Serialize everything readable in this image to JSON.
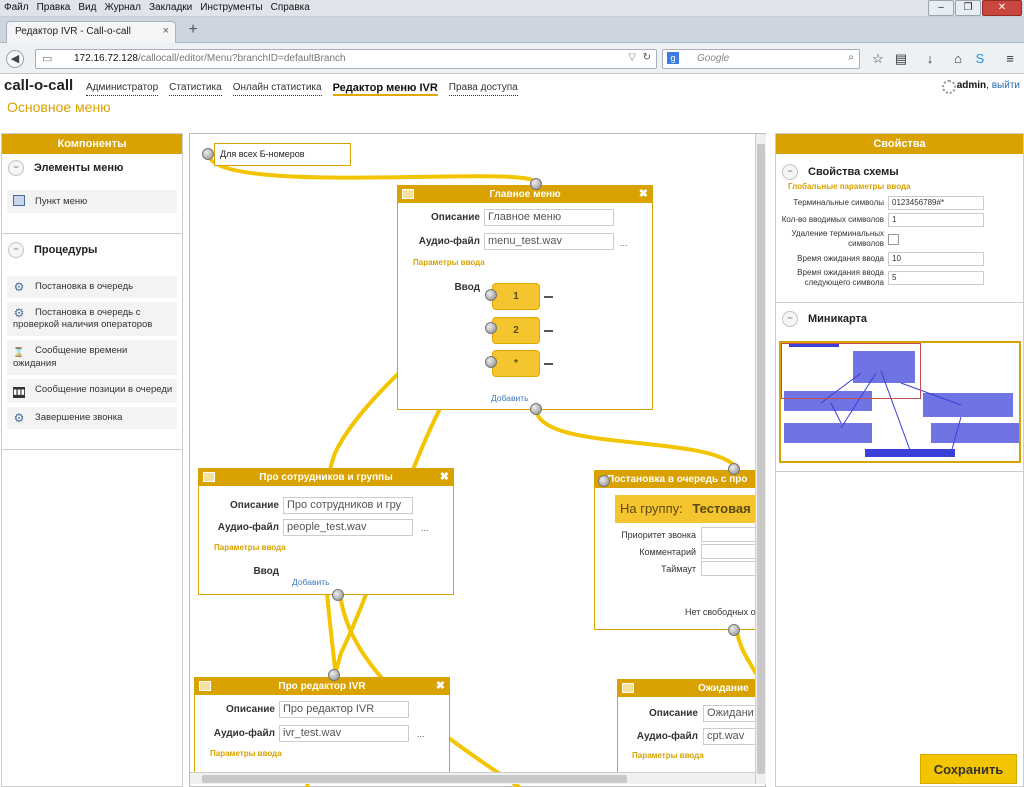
{
  "browser": {
    "menu": [
      "Файл",
      "Правка",
      "Вид",
      "Журнал",
      "Закладки",
      "Инструменты",
      "Справка"
    ],
    "tab_title": "Редактор IVR - Call-o-call",
    "url_host": "172.16.72.128",
    "url_path": "/callocall/editor/Menu?branchID=defaultBranch",
    "search_placeholder": "Google"
  },
  "app": {
    "logo": "call-o-call",
    "nav": [
      "Администратор",
      "Статистика",
      "Онлайн статистика",
      "Редактор меню IVR",
      "Права доступа"
    ],
    "active_nav": "Редактор меню IVR",
    "user": "admin",
    "user_sep": ",",
    "logout": "выйти",
    "page_title": "Основное меню",
    "save_label": "Сохранить"
  },
  "left_panel": {
    "title": "Компоненты",
    "sections": [
      {
        "title": "Элементы меню",
        "toggle": "−",
        "items": [
          {
            "label": "Пункт меню",
            "icon": "menu-item-icon"
          }
        ]
      },
      {
        "title": "Процедуры",
        "toggle": "−",
        "items": [
          {
            "label": "Постановка в очередь",
            "icon": "gear-icon"
          },
          {
            "label": "Постановка в очередь с проверкой наличия операторов",
            "icon": "gear-icon"
          },
          {
            "label": "Сообщение времени ожидания",
            "icon": "hourglass-icon"
          },
          {
            "label": "Сообщение позиции в очереди",
            "icon": "queue-position-icon"
          },
          {
            "label": "Завершение звонка",
            "icon": "gear-icon"
          }
        ]
      }
    ]
  },
  "right_panel": {
    "title": "Свойства",
    "schema": {
      "title": "Свойства схемы",
      "toggle": "−",
      "subtitle": "Глобальные параметры ввода",
      "rows": [
        {
          "label": "Терминальные символы",
          "value": "0123456789#*"
        },
        {
          "label": "Кол-во вводимых символов",
          "value": "1"
        },
        {
          "label": "Удаление терминальных символов",
          "checked": false
        },
        {
          "label": "Время ожидания ввода",
          "value": "10"
        },
        {
          "label": "Время ожидания ввода следующего символа",
          "value": "5"
        }
      ]
    },
    "minimap": {
      "title": "Миникарта",
      "toggle": "−"
    }
  },
  "canvas": {
    "start_node": "Для всех Б-номеров",
    "main_menu": {
      "title": "Главное меню",
      "desc_label": "Описание",
      "desc_value": "Главное меню",
      "audio_label": "Аудио-файл",
      "audio_value": "menu_test.wav",
      "params_link": "Параметры ввода",
      "input_label": "Ввод",
      "keys": [
        "1",
        "2",
        "*"
      ],
      "add": "Добавить",
      "dots": "..."
    },
    "employees": {
      "title": "Про сотрудников и группы",
      "desc_label": "Описание",
      "desc_value": "Про сотрудников и гру",
      "audio_label": "Аудио-файл",
      "audio_value": "people_test.wav",
      "params_link": "Параметры ввода",
      "input_label": "Ввод",
      "add": "Добавить",
      "dots": "..."
    },
    "queue": {
      "title": "Постановка в очередь с про",
      "group_label": "На группу:",
      "group_value": "Тестовая",
      "rows": [
        "Приоритет звонка",
        "Комментарий",
        "Таймаут"
      ],
      "no_free": "Нет свободных о"
    },
    "ivr_editor": {
      "title": "Про редактор IVR",
      "desc_label": "Описание",
      "desc_value": "Про редактор IVR",
      "audio_label": "Аудио-файл",
      "audio_value": "ivr_test.wav",
      "params_link": "Параметры ввода",
      "dots": "..."
    },
    "waiting": {
      "title": "Ожидание",
      "desc_label": "Описание",
      "desc_value": "Ожидани",
      "audio_label": "Аудио-файл",
      "audio_value": "cpt.wav",
      "params_link": "Параметры ввода"
    }
  },
  "colors": {
    "accent": "#d9a200",
    "wire": "#f2c500",
    "minimap_block": "#6f73e3",
    "link": "#3a7bbf"
  }
}
